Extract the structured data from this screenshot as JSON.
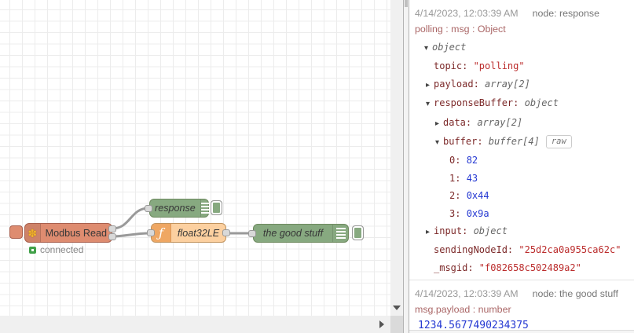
{
  "colors": {
    "modbus_node": "#de8c70",
    "debug_node_green": "#87a980",
    "function_node": "#fcd0a0",
    "wire": "#999999",
    "status_green": "#40a048",
    "debug_key": "#7c2929",
    "debug_string": "#bb2c2c",
    "debug_number": "#2438d2",
    "debug_meta_path": "#aa6666"
  },
  "icons": {
    "modbus_glyph": "✽",
    "function_glyph": "ƒ",
    "collapse_arrow": "▾",
    "expand_arrow": "▸"
  },
  "canvas": {
    "nodes": {
      "modbus": {
        "label": "Modbus Read",
        "status": "connected"
      },
      "response": {
        "label": "response"
      },
      "function": {
        "label": "float32LE"
      },
      "good_stuff": {
        "label": "the good stuff"
      }
    }
  },
  "debug": {
    "messages": [
      {
        "date": "4/14/2023, 12:03:39 AM",
        "node": "node: response",
        "path": "polling : msg : Object",
        "tree": [
          {
            "arrow": "▾",
            "key": "",
            "type": "object"
          },
          {
            "arrow": "",
            "key": "topic: ",
            "value": "\"polling\""
          },
          {
            "arrow": "▸",
            "key": "payload: ",
            "type": "array[2]"
          },
          {
            "arrow": "▾",
            "key": "responseBuffer: ",
            "type": "object"
          },
          {
            "arrow": "▸",
            "key": "data: ",
            "type": "array[2]"
          },
          {
            "arrow": "▾",
            "key": "buffer: ",
            "type": "buffer[4]",
            "raw_label": "raw"
          },
          {
            "arrow": "",
            "key": "0: ",
            "value": "82"
          },
          {
            "arrow": "",
            "key": "1: ",
            "value": "43"
          },
          {
            "arrow": "",
            "key": "2: ",
            "value": "0x44"
          },
          {
            "arrow": "",
            "key": "3: ",
            "value": "0x9a"
          },
          {
            "arrow": "▸",
            "key": "input: ",
            "type": "object"
          },
          {
            "arrow": "",
            "key": "sendingNodeId: ",
            "value": "\"25d2ca0a955ca62c\""
          },
          {
            "arrow": "",
            "key": "_msgid: ",
            "value": "\"f082658c502489a2\""
          }
        ]
      },
      {
        "date": "4/14/2023, 12:03:39 AM",
        "node": "node: the good stuff",
        "path": "msg.payload : number",
        "value": "1234.5677490234375"
      }
    ]
  }
}
